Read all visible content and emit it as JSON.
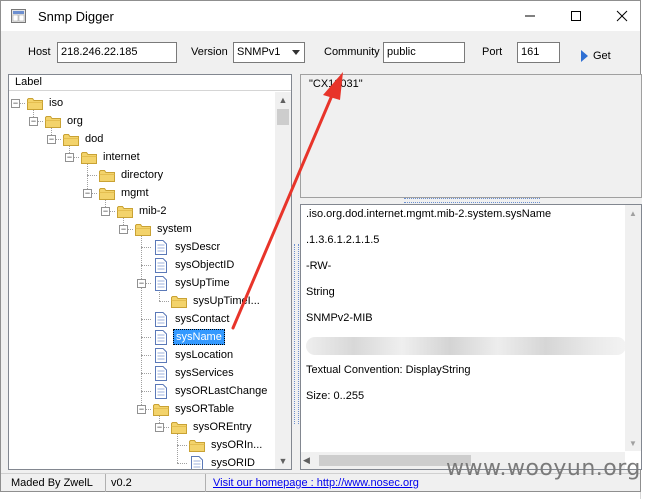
{
  "window": {
    "title": "Snmp Digger"
  },
  "toolbar": {
    "host_label": "Host",
    "host_value": "218.246.22.185",
    "version_label": "Version",
    "version_value": "SNMPv1",
    "community_label": "Community",
    "community_value": "public",
    "port_label": "Port",
    "port_value": "161",
    "get_label": "Get"
  },
  "tree": {
    "header": "Label",
    "nodes": [
      {
        "label": "iso",
        "kind": "folder",
        "level": 0,
        "expander": "minus"
      },
      {
        "label": "org",
        "kind": "folder",
        "level": 1,
        "expander": "minus"
      },
      {
        "label": "dod",
        "kind": "folder",
        "level": 2,
        "expander": "minus"
      },
      {
        "label": "internet",
        "kind": "folder",
        "level": 3,
        "expander": "minus"
      },
      {
        "label": "directory",
        "kind": "folder",
        "level": 4,
        "expander": "none"
      },
      {
        "label": "mgmt",
        "kind": "folder",
        "level": 4,
        "expander": "minus"
      },
      {
        "label": "mib-2",
        "kind": "folder",
        "level": 5,
        "expander": "minus"
      },
      {
        "label": "system",
        "kind": "folder",
        "level": 6,
        "expander": "minus"
      },
      {
        "label": "sysDescr",
        "kind": "doc",
        "level": 7,
        "expander": "none"
      },
      {
        "label": "sysObjectID",
        "kind": "doc",
        "level": 7,
        "expander": "none"
      },
      {
        "label": "sysUpTime",
        "kind": "doc",
        "level": 7,
        "expander": "minus"
      },
      {
        "label": "sysUpTimeI...",
        "kind": "folder",
        "level": 8,
        "expander": "none"
      },
      {
        "label": "sysContact",
        "kind": "doc",
        "level": 7,
        "expander": "none"
      },
      {
        "label": "sysName",
        "kind": "doc",
        "level": 7,
        "expander": "none",
        "selected": true
      },
      {
        "label": "sysLocation",
        "kind": "doc",
        "level": 7,
        "expander": "none"
      },
      {
        "label": "sysServices",
        "kind": "doc",
        "level": 7,
        "expander": "none"
      },
      {
        "label": "sysORLastChange",
        "kind": "doc",
        "level": 7,
        "expander": "none"
      },
      {
        "label": "sysORTable",
        "kind": "folder",
        "level": 7,
        "expander": "minus"
      },
      {
        "label": "sysOREntry",
        "kind": "folder",
        "level": 8,
        "expander": "minus"
      },
      {
        "label": "sysORIn...",
        "kind": "folder",
        "level": 9,
        "expander": "none"
      },
      {
        "label": "sysORID",
        "kind": "doc",
        "level": 9,
        "expander": "none"
      }
    ]
  },
  "value_panel": {
    "value": "\"CX12031\""
  },
  "details": {
    "oid_name": ".iso.org.dod.internet.mgmt.mib-2.system.sysName",
    "oid": ".1.3.6.1.2.1.1.5",
    "access": "-RW-",
    "type": "String",
    "module": "SNMPv2-MIB",
    "convention": "Textual Convention: DisplayString",
    "size": "Size: 0..255"
  },
  "status": {
    "author": "Maded By ZwelL",
    "version": "v0.2",
    "homepage": "Visit our homepage : http://www.nosec.org"
  },
  "watermark": "www.wooyun.org",
  "colors": {
    "selection": "#3399ff",
    "arrow": "#e8342a",
    "folder": "#f3d36b",
    "link": "#0000ee"
  }
}
